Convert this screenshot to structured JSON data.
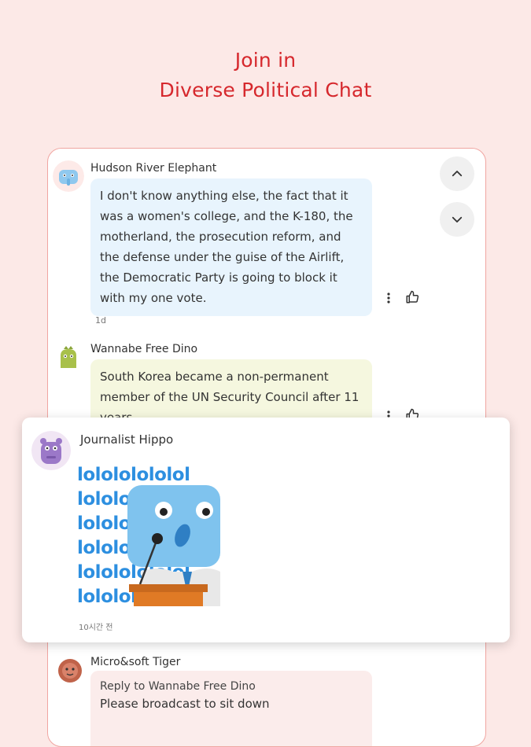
{
  "headline": {
    "line1": "Join in",
    "line2": "Diverse Political Chat"
  },
  "colors": {
    "accent": "#d6282d",
    "background": "#fce9e7"
  },
  "messages": [
    {
      "user": "Hudson River Elephant",
      "avatar": "elephant-avatar",
      "text": "I don't know anything else, the fact that it was a women's college, and the K-180, the motherland, the prosecution reform, and the defense under the guise of the Airlift, the Democratic Party is going to block it with my one vote.",
      "time": "1d",
      "bubble_color": "#e8f4fd"
    },
    {
      "user": "Wannabe Free Dino",
      "avatar": "dino-avatar",
      "text": "South Korea became a non-permanent member of the UN Security Council after 11 years.",
      "bubble_color": "#f5f7df"
    },
    {
      "user": "Micro&soft Tiger",
      "avatar": "tiger-avatar",
      "reply_to": "Reply to Wannabe Free Dino",
      "text": "Please broadcast to sit down",
      "bubble_color": "#fbeceb"
    }
  ],
  "popup": {
    "user": "Journalist Hippo",
    "avatar": "hippo-avatar",
    "sticker_text": "lolololololol",
    "time": "10시간 전"
  },
  "icons": {
    "scroll_up": "chevron-up-icon",
    "scroll_down": "chevron-down-icon",
    "more": "more-vertical-icon",
    "like": "thumbs-up-icon"
  }
}
